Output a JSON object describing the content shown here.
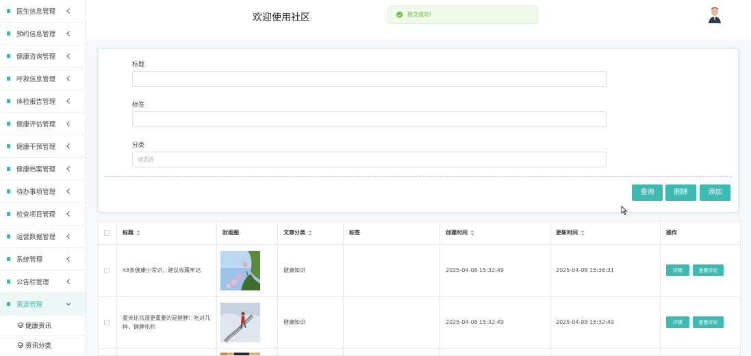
{
  "sidebar": {
    "items": [
      {
        "label": "医生信息管理"
      },
      {
        "label": "预约信息管理"
      },
      {
        "label": "健康咨询管理"
      },
      {
        "label": "呼救信息管理"
      },
      {
        "label": "体检报告管理"
      },
      {
        "label": "健康评估管理"
      },
      {
        "label": "健康干预管理"
      },
      {
        "label": "健康档案管理"
      },
      {
        "label": "待办事项管理"
      },
      {
        "label": "检查项目管理"
      },
      {
        "label": "运营数据管理"
      },
      {
        "label": "系统管理"
      },
      {
        "label": "公告栏管理"
      },
      {
        "label": "资源管理"
      }
    ],
    "sub_items": [
      {
        "label": "健康资讯"
      },
      {
        "label": "资讯分类"
      }
    ]
  },
  "header": {
    "welcome": "欢迎使用社区",
    "toast": "提交成功!"
  },
  "search": {
    "title_label": "标题",
    "tag_label": "标签",
    "category_label": "分类",
    "category_placeholder": "请选择",
    "query_button": "查询",
    "delete_button": "删除",
    "add_button": "添加"
  },
  "table": {
    "headers": {
      "title": "标题",
      "cover": "封面图",
      "category": "文章分类",
      "tag": "标签",
      "created": "创建时间",
      "updated": "更新时间",
      "actions": "操作"
    },
    "rows": [
      {
        "title": "48条健康小常识，建议收藏牢记",
        "category": "健康知识",
        "tag": "",
        "created": "2025-04-08 15:32:49",
        "updated": "2025-04-08 15:36:31",
        "detail": "详情",
        "comments": "查看评论"
      },
      {
        "title": "夏天比祛湿更重要的是健脾！吃对几样，健脾化积",
        "category": "健康知识",
        "tag": "",
        "created": "2025-04-08 15:32:49",
        "updated": "2025-04-08 15:32:49",
        "detail": "详情",
        "comments": "查看评论"
      }
    ]
  },
  "colors": {
    "accent": "#3dbab2",
    "toast_bg": "#f0f9eb",
    "toast_text": "#67c23a"
  }
}
